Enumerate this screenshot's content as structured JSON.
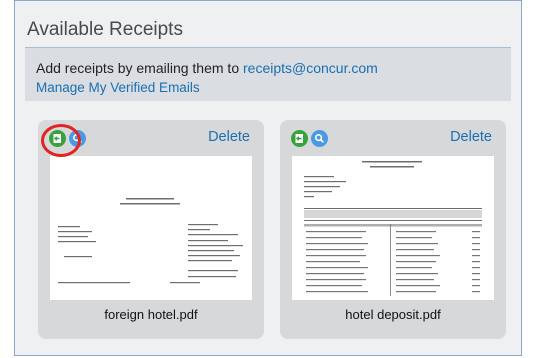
{
  "panel": {
    "title": "Available Receipts"
  },
  "info": {
    "text_prefix": "Add receipts by emailing them to ",
    "email": "receipts@concur.com",
    "manage_link": "Manage My Verified Emails"
  },
  "receipts": [
    {
      "filename": "foreign hotel.pdf",
      "delete_label": "Delete",
      "attach_icon": "attach-icon",
      "view_icon": "magnifier-icon"
    },
    {
      "filename": "hotel deposit.pdf",
      "delete_label": "Delete",
      "attach_icon": "attach-icon",
      "view_icon": "magnifier-icon"
    }
  ],
  "colors": {
    "link": "#1a6fb3",
    "attach_icon": "#37a33c",
    "view_icon": "#4a9ae3",
    "highlight": "#e32222"
  }
}
